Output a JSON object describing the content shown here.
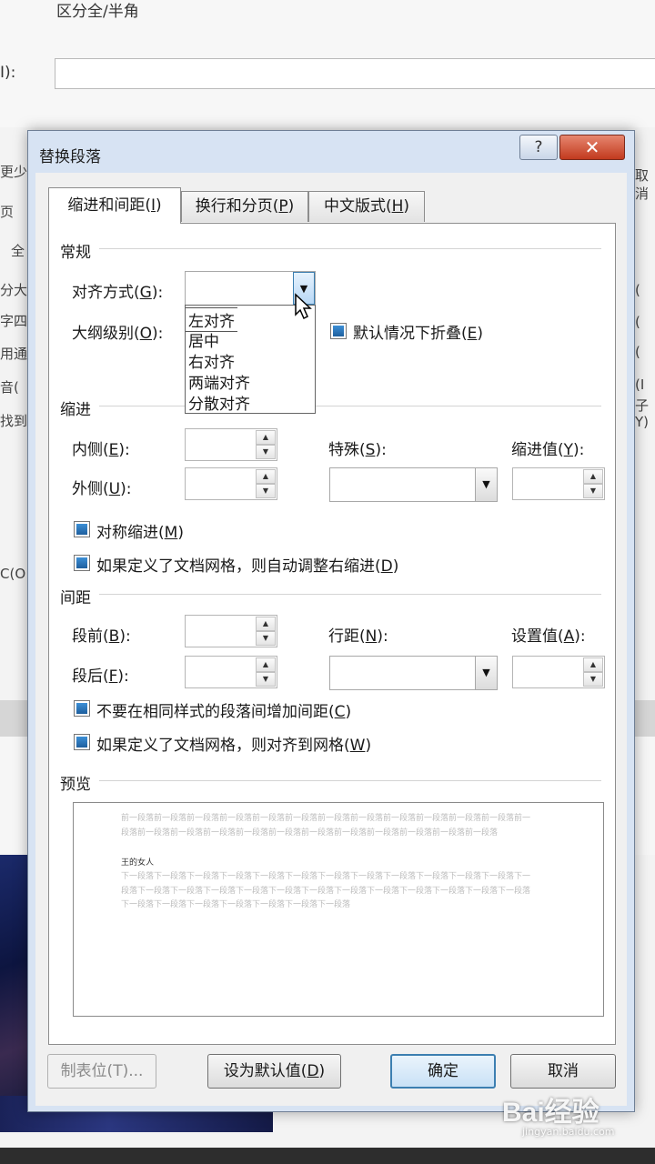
{
  "background": {
    "top_label": "区分全/半角",
    "field_label": "I):",
    "left_strip": [
      "更少",
      "页",
      "全",
      "分大",
      "字四",
      "用通",
      "音(",
      "找到",
      "C(O"
    ],
    "right_strip": [
      "取",
      "消",
      "(",
      "(",
      "(",
      "(I",
      "子",
      "Y)"
    ]
  },
  "dialog": {
    "title": "替换段落",
    "help_label": "?",
    "close_label": "✕",
    "tabs": [
      {
        "label": "缩进和间距(",
        "key": "I",
        "tail": ")"
      },
      {
        "label": "换行和分页(",
        "key": "P",
        "tail": ")"
      },
      {
        "label": "中文版式(",
        "key": "H",
        "tail": ")"
      }
    ],
    "general": {
      "section": "常规",
      "alignment_label": "对齐方式(",
      "alignment_key": "G",
      "alignment_tail": "):",
      "alignment_value": "",
      "alignment_options": [
        "左对齐",
        "居中",
        "右对齐",
        "两端对齐",
        "分散对齐"
      ],
      "outline_label": "大纲级别(",
      "outline_key": "O",
      "outline_tail": "):",
      "collapse_label": "默认情况下折叠(",
      "collapse_key": "E",
      "collapse_tail": ")"
    },
    "indent": {
      "section": "缩进",
      "inside_label": "内侧(",
      "inside_key": "E",
      "inside_tail": "):",
      "outside_label": "外侧(",
      "outside_key": "U",
      "outside_tail": "):",
      "special_label": "特殊(",
      "special_key": "S",
      "special_tail": "):",
      "indent_value_label": "缩进值(",
      "indent_value_key": "Y",
      "indent_value_tail": "):",
      "mirror_label": "对称缩进(",
      "mirror_key": "M",
      "mirror_tail": ")",
      "auto_adjust_label": "如果定义了文档网格，则自动调整右缩进(",
      "auto_adjust_key": "D",
      "auto_adjust_tail": ")"
    },
    "spacing": {
      "section": "间距",
      "before_label": "段前(",
      "before_key": "B",
      "before_tail": "):",
      "after_label": "段后(",
      "after_key": "F",
      "after_tail": "):",
      "line_spacing_label": "行距(",
      "line_spacing_key": "N",
      "line_spacing_tail": "):",
      "at_label": "设置值(",
      "at_key": "A",
      "at_tail": "):",
      "no_space_label": "不要在相同样式的段落间增加间距(",
      "no_space_key": "C",
      "no_space_tail": ")",
      "snap_grid_label": "如果定义了文档网格，则对齐到网格(",
      "snap_grid_key": "W",
      "snap_grid_tail": ")"
    },
    "preview": {
      "section": "预览",
      "prev_text": "前一段落前一段落前一段落前一段落前一段落前一段落前一段落前一段落前一段落前一段落前一段落前一段落前一段落前一段落前一段落前一段落前一段落前一段落前一段落前一段落前一段落前一段落前一段落前一段落",
      "main_text": "王的女人",
      "next_text": "下一段落下一段落下一段落下一段落下一段落下一段落下一段落下一段落下一段落下一段落下一段落下一段落下一段落下一段落下一段落下一段落下一段落下一段落下一段落下一段落下一段落下一段落下一段落下一段落下一段落下一段落下一段落下一段落下一段落下一段落下一段落下一段落"
    },
    "buttons": {
      "tabs_label": "制表位(T)...",
      "default_label": "设为默认值(",
      "default_key": "D",
      "default_tail": ")",
      "ok_label": "确定",
      "cancel_label": "取消"
    }
  },
  "watermark": {
    "logo": "Bai经验",
    "sub": "jingyan.baidu.com"
  }
}
